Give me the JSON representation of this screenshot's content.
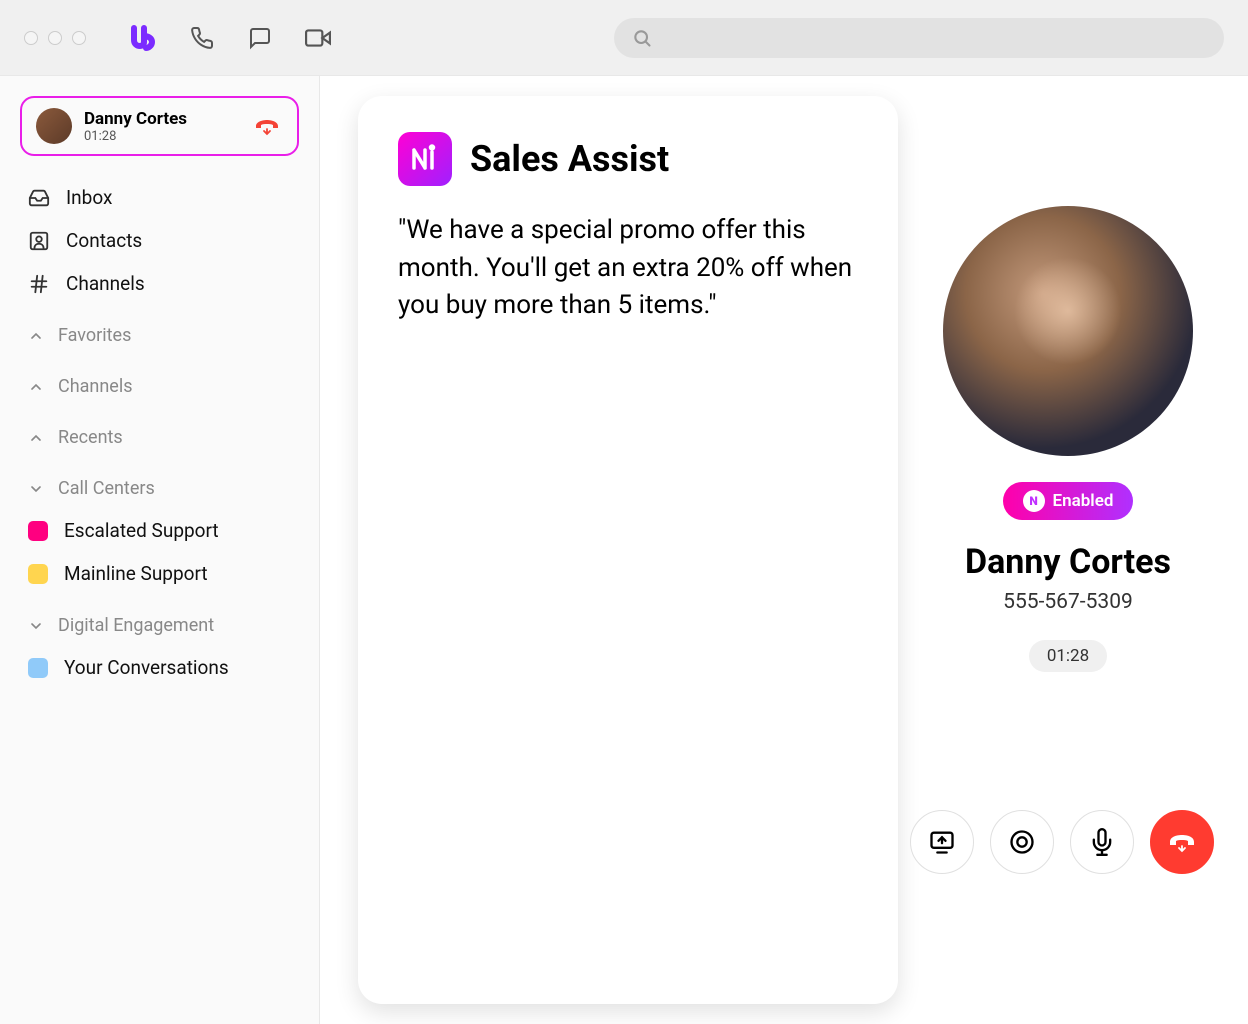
{
  "topbar": {
    "search_placeholder": ""
  },
  "sidebar": {
    "active_call": {
      "name": "Danny Cortes",
      "duration": "01:28"
    },
    "nav": {
      "inbox": "Inbox",
      "contacts": "Contacts",
      "channels": "Channels"
    },
    "sections": {
      "favorites": "Favorites",
      "channels": "Channels",
      "recents": "Recents",
      "call_centers": "Call Centers",
      "digital_engagement": "Digital Engagement"
    },
    "call_centers": {
      "escalated": "Escalated Support",
      "mainline": "Mainline Support"
    },
    "digital": {
      "your_conversations": "Your Conversations"
    }
  },
  "assist": {
    "title": "Sales Assist",
    "body": "\"We have a special promo offer this month. You'll get an extra 20% off when you buy more than 5 items.\""
  },
  "contact": {
    "badge": "Enabled",
    "name": "Danny Cortes",
    "phone": "555-567-5309",
    "duration": "01:28"
  }
}
